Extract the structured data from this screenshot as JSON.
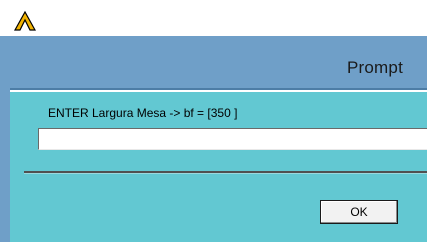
{
  "app": {
    "logo_icon": "ansys-caret-logo-icon",
    "logo_color": "#f2b300"
  },
  "dialog": {
    "title": "Prompt",
    "prompt_text": "ENTER Largura Mesa -> bf = [350 ]",
    "input_value": "",
    "ok_label": "OK"
  },
  "colors": {
    "title_bar": "#6f9fc8",
    "client_area": "#62c8d2"
  }
}
